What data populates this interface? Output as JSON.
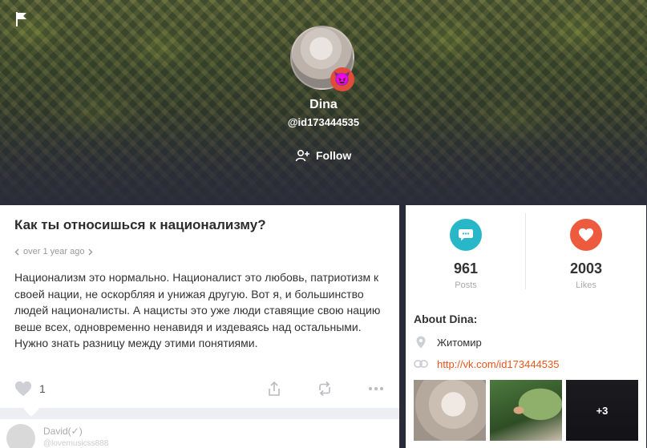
{
  "profile": {
    "name": "Dina",
    "handle": "@id173444535",
    "follow_label": "Follow"
  },
  "post": {
    "title": "Как ты относишься к национализму?",
    "time": "over 1 year ago",
    "body": "Национализм это нормально. Националист это любовь, патриотизм к своей нации, не оскорбляя и унижая другую. Вот я, и большинство людей националисты. А нацисты это уже люди ставящие свою нацию веше всех, одновременно ненавидя и издеваясь над остальными. Нужно знать разницу между этими понятиями.",
    "like_count": "1"
  },
  "comment": {
    "author": "David(✓)",
    "handle": "@lovemusicss888"
  },
  "stats": {
    "posts": {
      "value": "961",
      "label": "Posts"
    },
    "likes": {
      "value": "2003",
      "label": "Likes"
    }
  },
  "about": {
    "title": "About Dina:",
    "location": "Житомир",
    "link": "http://vk.com/id173444535"
  },
  "photos": {
    "more_label": "+3"
  },
  "colors": {
    "accent_teal": "#27b7c9",
    "accent_red": "#ee5a3d",
    "link": "#e9561b",
    "badge": "#e14b3a"
  },
  "icons": [
    "flag-icon",
    "devil-face-icon",
    "add-user-icon",
    "chevron-left-icon",
    "chevron-right-icon",
    "heart-icon",
    "share-icon",
    "repost-icon",
    "more-icon",
    "message-icon",
    "location-icon",
    "link-icon"
  ]
}
